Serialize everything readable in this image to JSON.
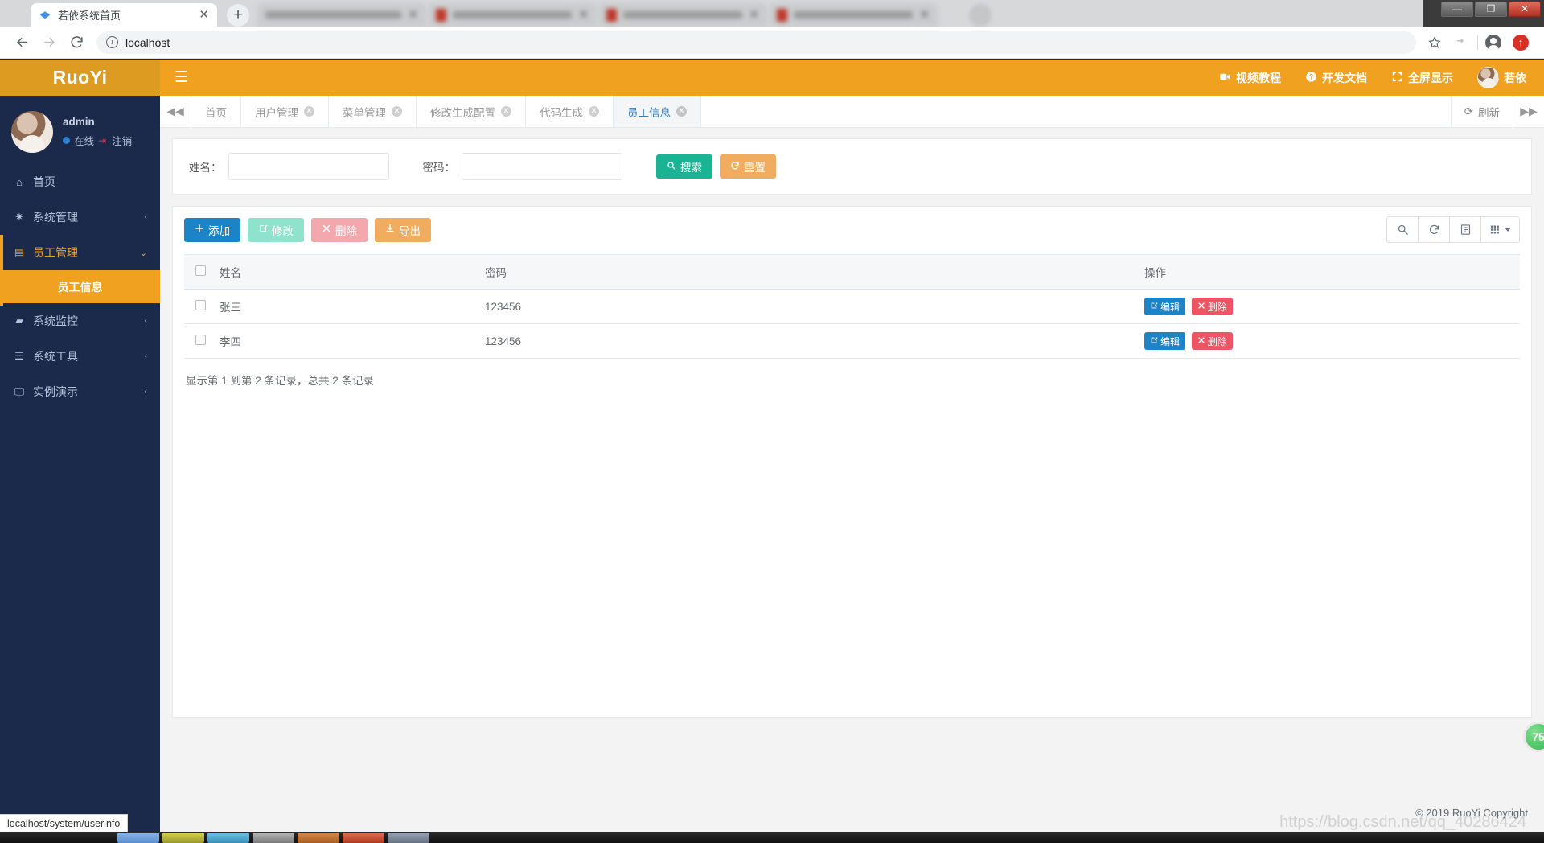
{
  "browser": {
    "active_tab_title": "若依系统首页",
    "tab_close": "✕",
    "newtab_label": "+",
    "blurred_tab_count": 4,
    "url": "localhost",
    "status_text": "localhost/system/userinfo",
    "window_controls": {
      "minimize": "—",
      "maximize": "❐",
      "close": "✕"
    }
  },
  "sidebar": {
    "brand": "RuoYi",
    "user": {
      "name": "admin",
      "status_label": "在线",
      "logout_label": "注销"
    },
    "items": [
      {
        "icon": "home-icon",
        "label": "首页",
        "caret": "",
        "state": "plain"
      },
      {
        "icon": "gear-icon",
        "label": "系统管理",
        "caret": "‹",
        "state": "plain"
      },
      {
        "icon": "user-card-icon",
        "label": "员工管理",
        "caret": "⌄",
        "state": "open"
      },
      {
        "icon": "video-icon",
        "label": "系统监控",
        "caret": "‹",
        "state": "plain"
      },
      {
        "icon": "list-icon",
        "label": "系统工具",
        "caret": "‹",
        "state": "plain"
      },
      {
        "icon": "monitor-icon",
        "label": "实例演示",
        "caret": "‹",
        "state": "plain"
      }
    ],
    "submenu": {
      "label": "员工信息"
    }
  },
  "topbar": {
    "hamburger": "☰",
    "links": [
      {
        "icon": "video-camera-icon",
        "label": "视频教程"
      },
      {
        "icon": "question-circle-icon",
        "label": "开发文档"
      },
      {
        "icon": "expand-icon",
        "label": "全屏显示"
      }
    ],
    "username": "若依"
  },
  "tabbar": {
    "prev_arrow": "◀◀",
    "next_arrow": "▶▶",
    "refresh_label": "刷新",
    "tabs": [
      {
        "label": "首页",
        "closable": false,
        "active": false
      },
      {
        "label": "用户管理",
        "closable": true,
        "active": false
      },
      {
        "label": "菜单管理",
        "closable": true,
        "active": false
      },
      {
        "label": "修改生成配置",
        "closable": true,
        "active": false
      },
      {
        "label": "代码生成",
        "closable": true,
        "active": false
      },
      {
        "label": "员工信息",
        "closable": true,
        "active": true
      }
    ],
    "close_glyph": "✕"
  },
  "search_form": {
    "fields": [
      {
        "label": "姓名：",
        "value": "",
        "placeholder": ""
      },
      {
        "label": "密码：",
        "value": "",
        "placeholder": ""
      }
    ],
    "search_button": "搜索",
    "reset_button": "重置"
  },
  "toolbar": {
    "buttons": [
      {
        "label": "添加",
        "icon": "plus-icon",
        "style": "add"
      },
      {
        "label": "修改",
        "icon": "pencil-square-icon",
        "style": "edit"
      },
      {
        "label": "删除",
        "icon": "x-icon",
        "style": "delete"
      },
      {
        "label": "导出",
        "icon": "download-icon",
        "style": "export"
      }
    ],
    "icon_buttons": [
      {
        "name": "search-icon"
      },
      {
        "name": "refresh-icon"
      },
      {
        "name": "toggle-view-icon"
      },
      {
        "name": "columns-icon"
      }
    ]
  },
  "table": {
    "columns": [
      "姓名",
      "密码",
      "操作"
    ],
    "rows": [
      {
        "name": "张三",
        "password": "123456"
      },
      {
        "name": "李四",
        "password": "123456"
      }
    ],
    "row_actions": {
      "edit": "编辑",
      "delete": "删除"
    },
    "pagination_info": "显示第 1 到第 2 条记录，总共 2 条记录"
  },
  "footer": {
    "copyright": "© 2019 RuoYi Copyright",
    "watermark": "https://blog.csdn.net/qq_40286424",
    "score_badge": "75"
  },
  "colors": {
    "brand_orange": "#f0a120",
    "sidebar_navy": "#1b2a4a",
    "primary_blue": "#1c84c6",
    "success_green": "#1ab394",
    "danger_red": "#ed5565"
  }
}
